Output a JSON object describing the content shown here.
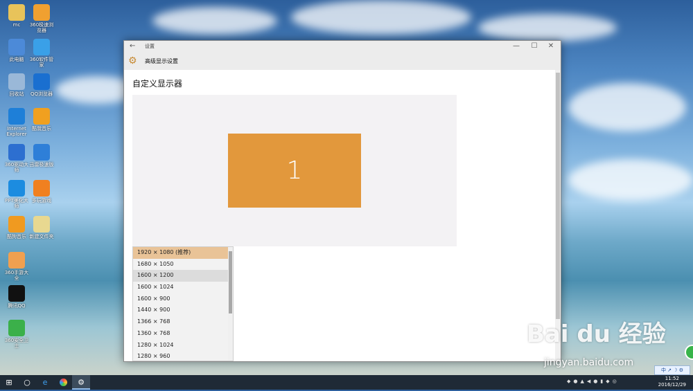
{
  "desktop": {
    "icons": [
      {
        "label": "mc",
        "color": "#e8c35a"
      },
      {
        "label": "360极速浏览器",
        "color": "#f0a030"
      },
      {
        "label": "此电脑",
        "color": "#4c8ad8"
      },
      {
        "label": "360软件管家",
        "color": "#3aa0e8"
      },
      {
        "label": "回收站",
        "color": "#9ab8d8"
      },
      {
        "label": "QQ浏览器",
        "color": "#1a6fd0"
      },
      {
        "label": "Internet Explorer",
        "color": "#1e7fd8"
      },
      {
        "label": "酷我音乐",
        "color": "#f0a020"
      },
      {
        "label": "360驱动大师",
        "color": "#2d6fd0"
      },
      {
        "label": "迅雷极速版",
        "color": "#2e7fd8"
      },
      {
        "label": "PPT美化大师",
        "color": "#1c8ce0"
      },
      {
        "label": "多玩游戏",
        "color": "#f08020"
      },
      {
        "label": "酷狗音乐",
        "color": "#f09a20"
      },
      {
        "label": "新建文件夹",
        "color": "#e8d890"
      },
      {
        "label": "360手游大全",
        "color": "#f0a050"
      },
      {
        "label": "腾讯QQ",
        "color": "#111111"
      },
      {
        "label": "360安全卫士",
        "color": "#3bb04a"
      }
    ]
  },
  "window": {
    "back_glyph": "←",
    "app_title": "设置",
    "min_glyph": "—",
    "max_glyph": "☐",
    "close_glyph": "✕",
    "section_title": "高级显示设置",
    "page_title": "自定义显示器",
    "monitor_number": "1",
    "accent_color": "#e2983c",
    "resolutions": [
      "1920 × 1080 (推荐)",
      "1680 × 1050",
      "1600 × 1200",
      "1600 × 1024",
      "1600 × 900",
      "1440 × 900",
      "1366 × 768",
      "1360 × 768",
      "1280 × 1024",
      "1280 × 960"
    ],
    "selected_resolution": "1920 × 1080 (推荐)"
  },
  "taskbar": {
    "start_glyph": "⊞",
    "search_glyph": "○",
    "time": "11:52",
    "date": "2016/12/29",
    "ime_label": "中 ↗ ☽ ⚙"
  },
  "watermark": {
    "brand": "Bai du 经验",
    "url": "jingyan.baidu.com"
  }
}
